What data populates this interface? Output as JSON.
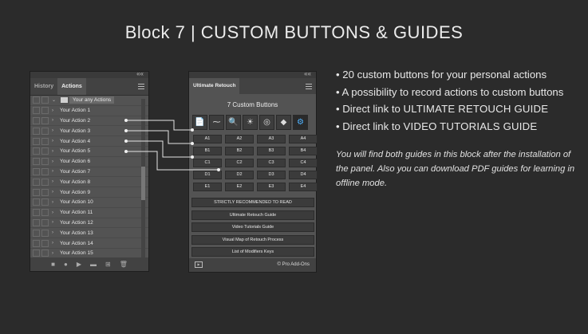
{
  "title": "Block 7 | CUSTOM BUTTONS & GUIDES",
  "left_panel": {
    "collapse": "««",
    "tabs": [
      "History",
      "Actions"
    ],
    "set_name": "Your any Actions",
    "actions": [
      "Your Action 1",
      "Your Action 2",
      "Your Action 3",
      "Your Action 4",
      "Your Action 5",
      "Your Action 6",
      "Your Action 7",
      "Your Action 8",
      "Your Action 9",
      "Your Action 10",
      "Your Action 11",
      "Your Action 12",
      "Your Action 13",
      "Your Action 14",
      "Your Action 15"
    ],
    "bottom_icons": [
      "■",
      "●",
      "▶",
      "▬",
      "⊞",
      "🗑"
    ]
  },
  "right_panel": {
    "collapse": "««",
    "tab": "Ultimate Retouch",
    "heading": "7 Custom Buttons",
    "icons": [
      "📄",
      "⁓",
      "🔍",
      "☀",
      "◎",
      "◆",
      "⚙"
    ],
    "grid": [
      [
        "A1",
        "A2",
        "A3",
        "A4"
      ],
      [
        "B1",
        "B2",
        "B3",
        "B4"
      ],
      [
        "C1",
        "C2",
        "C3",
        "C4"
      ],
      [
        "D1",
        "D2",
        "D3",
        "D4"
      ],
      [
        "E1",
        "E2",
        "E3",
        "E4"
      ]
    ],
    "buttons": [
      "STRICTLY RECOMMENDED TO READ",
      "Ultimate Retouch Guide",
      "Video Tutorials Guide",
      "Visual Map of Retouch Process",
      "List of Modifiers Keys"
    ],
    "footer_play": "▶",
    "footer_copy": "© Pro Add-Ons"
  },
  "bullets": {
    "b1": "• 20 custom buttons for your personal actions",
    "b2": "• A possibility to record actions to custom buttons",
    "b3_pre": "• Direct link to ",
    "b3_strong": "ULTIMATE RETOUCH GUIDE",
    "b4_pre": "• Direct link to ",
    "b4_strong": "VIDEO TUTORIALS GUIDE"
  },
  "description": "You will find both guides in this block after the installation of the panel. Also you can download PDF guides for learning in offline mode."
}
